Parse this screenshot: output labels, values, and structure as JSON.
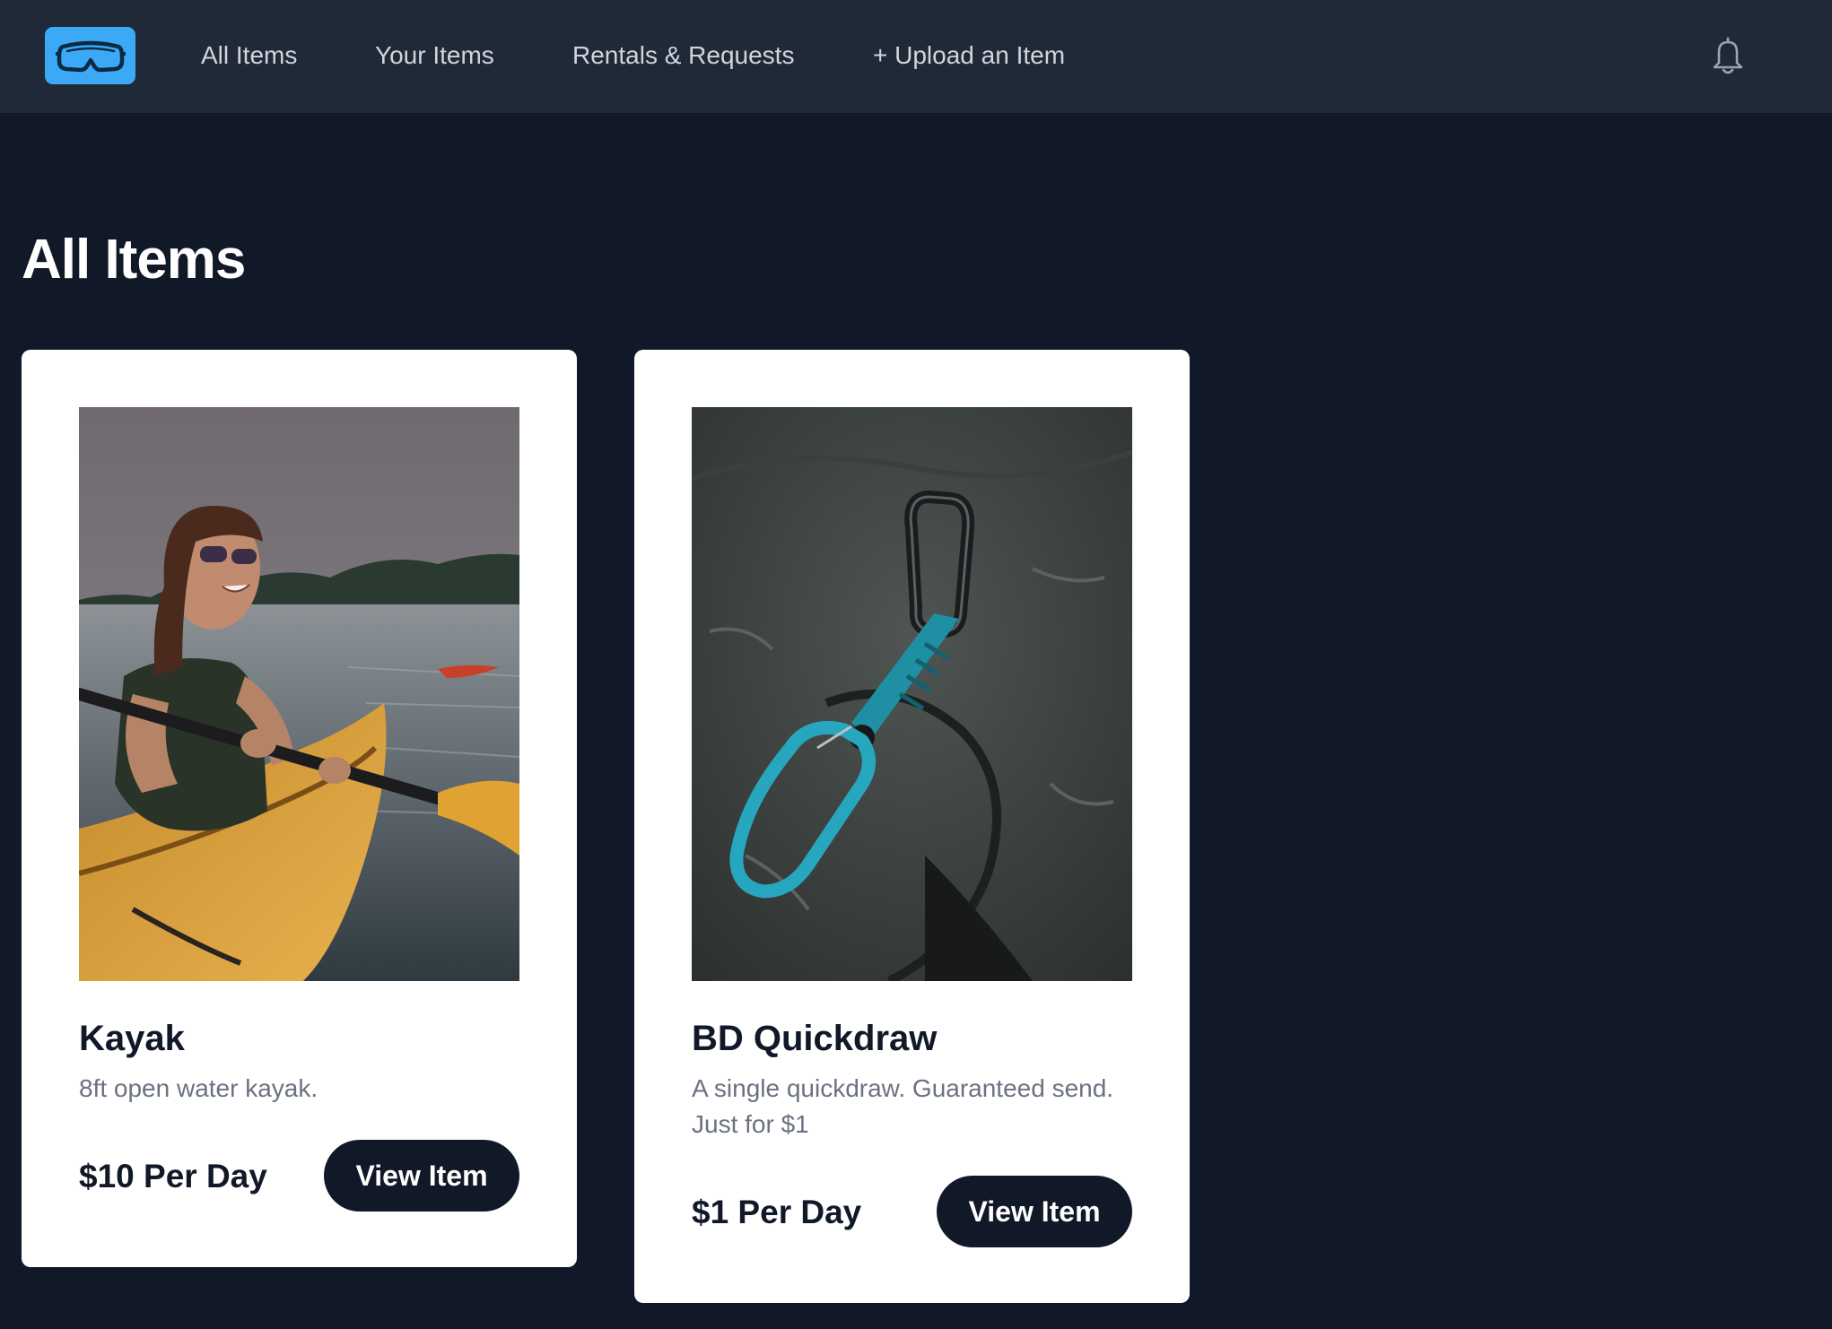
{
  "nav": {
    "logo_icon": "goggles-icon",
    "links": [
      "All Items",
      "Your Items",
      "Rentals & Requests",
      "+ Upload an Item"
    ],
    "notification_icon": "bell-icon"
  },
  "page": {
    "title": "All Items"
  },
  "items": [
    {
      "title": "Kayak",
      "description": "8ft open water kayak.",
      "price": "$10 Per Day",
      "button": "View Item",
      "image_icon": "kayak-photo"
    },
    {
      "title": "BD Quickdraw",
      "description": "A single quickdraw. Guaranteed send. Just for $1",
      "price": "$1 Per Day",
      "button": "View Item",
      "image_icon": "quickdraw-photo"
    }
  ],
  "colors": {
    "background": "#111827",
    "navbar": "#1f2937",
    "logo_accent": "#3ba9f5",
    "button": "#111827",
    "muted_text": "#6b7280"
  }
}
